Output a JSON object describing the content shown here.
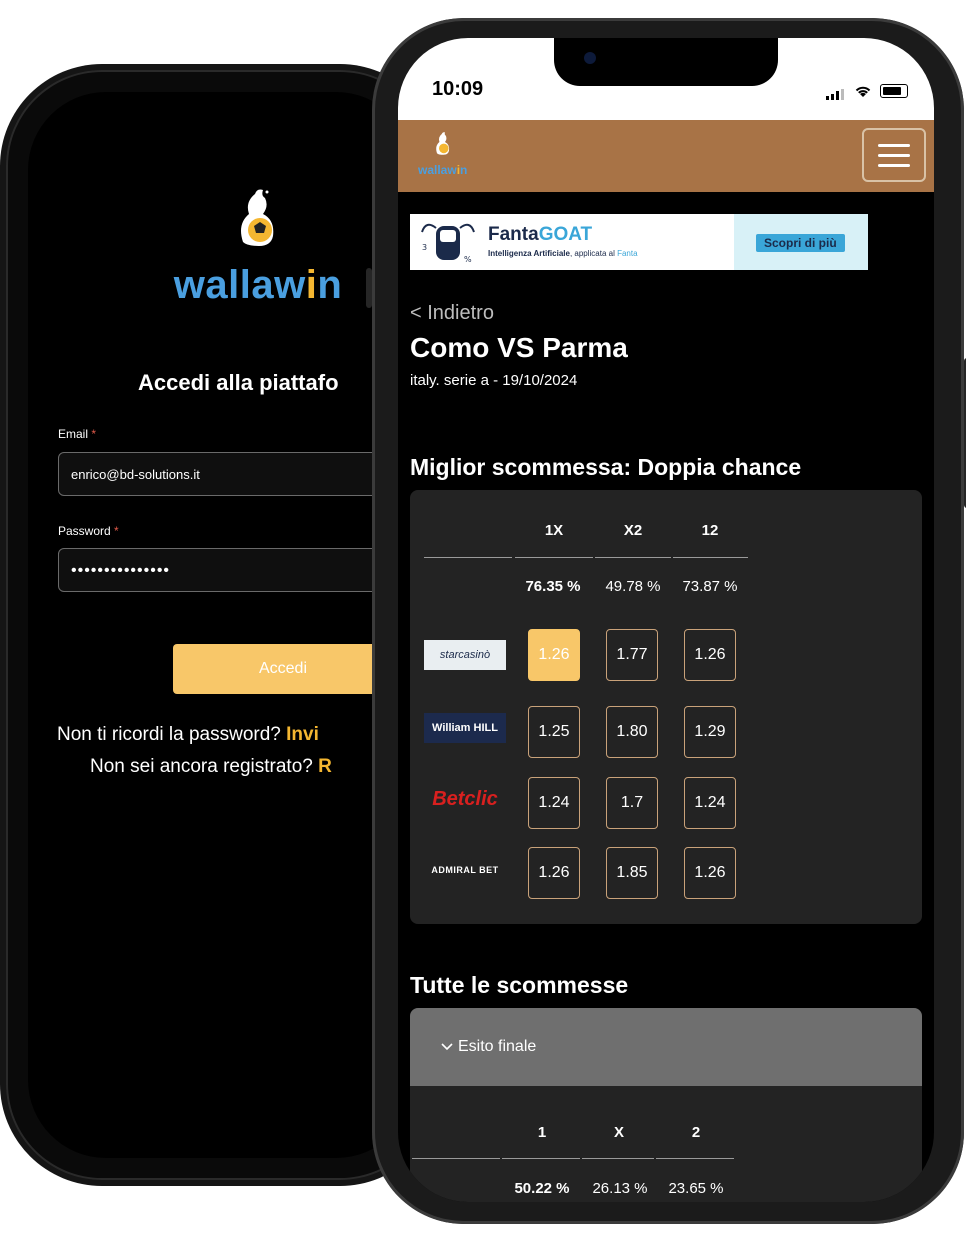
{
  "login": {
    "brand": "wallawin",
    "title": "Accedi alla piattafo",
    "email_label": "Email",
    "email_value": "enrico@bd-solutions.it",
    "password_label": "Password",
    "password_value": "•••••••••••••••",
    "required_mark": "*",
    "submit_label": "Accedi",
    "forgot_text": "Non ti ricordi la password?",
    "forgot_link": "Invi",
    "register_text": "Non sei ancora registrato?",
    "register_link": "R"
  },
  "status_bar": {
    "time": "10:09"
  },
  "header": {
    "brand": "wallawin",
    "menu_icon": "hamburger-icon"
  },
  "ad": {
    "brand_main": "Fanta",
    "brand_accent": "GOAT",
    "tagline_bold": "Intelligenza Artificiale",
    "tagline_rest": ", applicata al ",
    "tagline_hl": "Fanta",
    "cta": "Scopri di più"
  },
  "nav": {
    "back_label": "<  Indietro"
  },
  "match": {
    "title": "Como VS Parma",
    "subtitle": "italy. serie a - 19/10/2024"
  },
  "best_bet": {
    "section_title": "Miglior scommessa: Doppia chance",
    "columns": [
      "1X",
      "X2",
      "12"
    ],
    "percentages": [
      "76.35 %",
      "49.78 %",
      "73.87 %"
    ],
    "bookmakers": [
      {
        "name": "starcasinò",
        "odds": [
          "1.26",
          "1.77",
          "1.26"
        ]
      },
      {
        "name": "William HILL",
        "odds": [
          "1.25",
          "1.80",
          "1.29"
        ]
      },
      {
        "name": "Betclic",
        "odds": [
          "1.24",
          "1.7",
          "1.24"
        ]
      },
      {
        "name": "ADMIRAL BET",
        "odds": [
          "1.26",
          "1.85",
          "1.26"
        ]
      }
    ]
  },
  "all_bets": {
    "section_title": "Tutte le scommesse",
    "accordion_label": "Esito finale",
    "columns": [
      "1",
      "X",
      "2"
    ],
    "percentages": [
      "50.22 %",
      "26.13 %",
      "23.65 %"
    ]
  },
  "colors": {
    "accent": "#f8c769",
    "header_bg": "#a87346",
    "brand_blue": "#4a9fe0",
    "brand_yellow": "#f5b731"
  }
}
